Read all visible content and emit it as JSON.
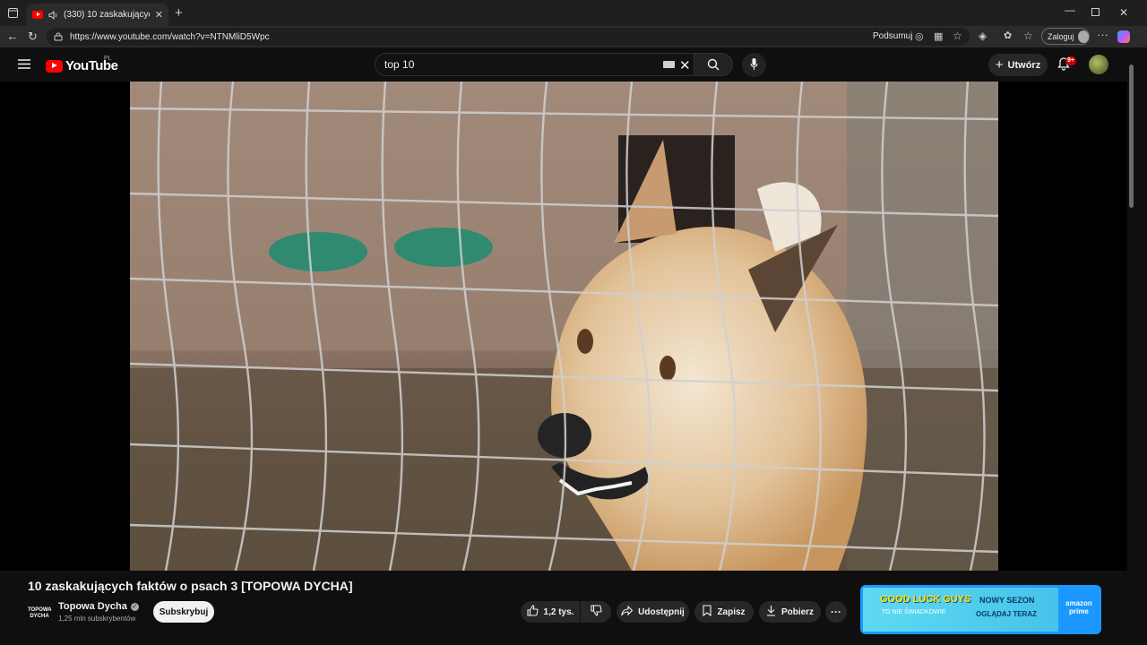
{
  "browser": {
    "tab_title": "(330) 10 zaskakujących faktó",
    "url": "https://www.youtube.com/watch?v=NTNMliD5Wpc",
    "summarize_label": "Podsumuj",
    "login_label": "Zaloguj"
  },
  "header": {
    "logo_text": "YouTube",
    "region": "PL",
    "search_value": "top 10",
    "create_label": "Utwórz",
    "notifications_badge": "9+"
  },
  "video": {
    "title": "10 zaskakujących faktów o psach 3 [TOPOWA DYCHA]"
  },
  "channel": {
    "logo_line1": "TOPOWA",
    "logo_line2": "DYCHA",
    "name": "Topowa Dycha",
    "subscribers": "1,25 mln subskrybentów",
    "subscribe_label": "Subskrybuj"
  },
  "actions": {
    "likes": "1,2 tys.",
    "share_label": "Udostępnij",
    "save_label": "Zapisz",
    "download_label": "Pobierz"
  },
  "ad": {
    "headline": "GOOD LUCK GUYS",
    "subtitle": "TO NIE ŚWIADKOWIE",
    "season": "NOWY SEZON",
    "cta": "OGLĄDAJ TERAZ",
    "brand_line1": "amazon",
    "brand_line2": "prime"
  },
  "colors": {
    "background": "#0f0f0f",
    "brand_red": "#ff0000",
    "pill": "#272727",
    "subscribe": "#f1f1f1"
  }
}
